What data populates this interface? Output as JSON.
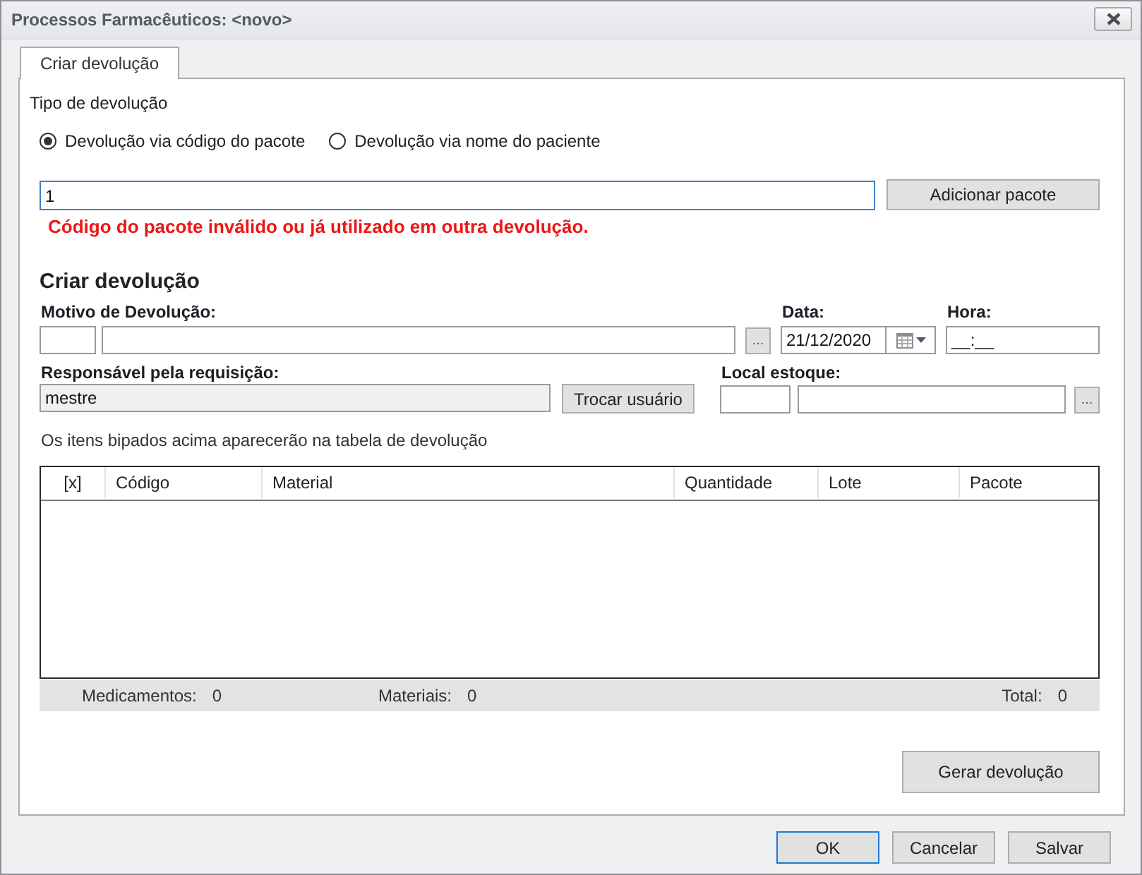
{
  "window": {
    "title": "Processos Farmacêuticos: <novo>"
  },
  "tabs": [
    {
      "label": "Criar devolução",
      "selected": true
    }
  ],
  "return_type": {
    "label": "Tipo de devolução",
    "options": [
      {
        "label": "Devolução via código do pacote",
        "selected": true
      },
      {
        "label": "Devolução via nome do paciente",
        "selected": false
      }
    ]
  },
  "package_entry": {
    "value": "1",
    "focused": true,
    "button": "Adicionar pacote",
    "error": "Código do pacote inválido ou já utilizado em outra devolução."
  },
  "form": {
    "title": "Criar devolução",
    "reason": {
      "label": "Motivo de Devolução:",
      "browse": "..."
    },
    "date": {
      "label": "Data:",
      "value": "21/12/2020"
    },
    "time": {
      "label": "Hora:",
      "value": "__:__"
    },
    "requester": {
      "label": "Responsável pela requisição:",
      "value": "mestre",
      "button": "Trocar usuário"
    },
    "stock_location": {
      "label": "Local estoque:",
      "browse": "..."
    }
  },
  "hint": "Os itens bipados acima aparecerão na tabela de devolução",
  "table": {
    "columns": [
      "[x]",
      "Código",
      "Material",
      "Quantidade",
      "Lote",
      "Pacote"
    ]
  },
  "totals": [
    {
      "label": "Medicamentos:",
      "value": "0"
    },
    {
      "label": "Materiais:",
      "value": "0"
    },
    {
      "label": "Total:",
      "value": "0"
    }
  ],
  "generate_button": "Gerar devolução",
  "buttons": [
    {
      "label": "OK",
      "default": true
    },
    {
      "label": "Cancelar",
      "default": false
    },
    {
      "label": "Salvar",
      "default": false
    }
  ]
}
